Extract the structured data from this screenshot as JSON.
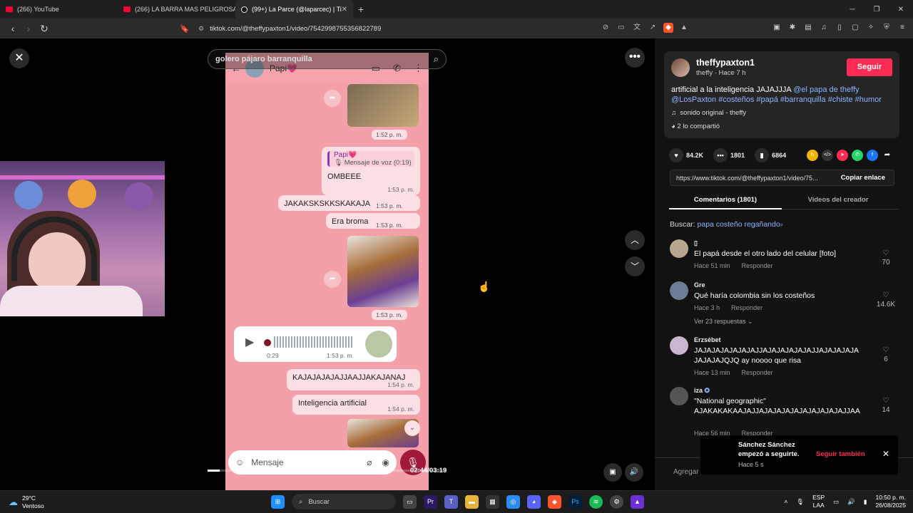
{
  "browser": {
    "tabs": [
      {
        "title": "(266) YouTube",
        "favicon": "youtube-icon"
      },
      {
        "title": "(266) LA BARRA MAS PELIGROSA DE",
        "favicon": "youtube-icon"
      },
      {
        "title": "(99+) La Parce (@laparcec) | Ti",
        "favicon": "tiktok-icon",
        "active": true
      }
    ],
    "new_tab": "+",
    "url": "tiktok.com/@theffypaxton1/video/7542998755356822789"
  },
  "video": {
    "search_query": "golero pájaro barranquilla",
    "time_current": "02:44",
    "time_total": "03:19",
    "progress": 0.05,
    "chat": {
      "contact": "Papi💗",
      "t1": "1:52 p. m.",
      "reply_name": "Papi💗",
      "reply_sub": "🎙 Mensaje de voz (0:19)",
      "m1": "OMBEEE",
      "m1_time": "1:53 p. m.",
      "m2": "JAKAKSKSKKSKAKAJA",
      "m2_time": "1:53 p. m.",
      "m3": "Era broma",
      "m3_time": "1:53 p. m.",
      "t2": "1:53 p. m.",
      "voice_len": "0:29",
      "voice_time": "1:53 p. m.",
      "m4": "KAJAJAJAJAJJAAJJAKAJANAJ",
      "m4_time": "1:54 p. m.",
      "m5": "Inteligencia artificial",
      "m5_time": "1:54 p. m.",
      "input_placeholder": "Mensaje"
    }
  },
  "post": {
    "username": "theffypaxton1",
    "subline": "theffy · Hace 7 h",
    "follow_label": "Seguir",
    "caption_text": "artificial a la inteligencia JAJAJJJA ",
    "caption_tags": "@el papa de theffy @LosPaxton #costeños #papá #barranquilla #chiste #humor",
    "sound": "sonido original - theffy",
    "shared": "2 lo compartió",
    "likes": "84.2K",
    "comments": "1801",
    "saves": "6864",
    "link": "https://www.tiktok.com/@theffypaxton1/video/75...",
    "copy_label": "Copiar enlace",
    "tab_comments": "Comentarios (1801)",
    "tab_videos": "Videos del creador",
    "search_prefix": "Buscar: ",
    "search_link": "papa costeño regañando",
    "add_comment_placeholder": "Agregar"
  },
  "comments": [
    {
      "name": "▯",
      "text": "El papá desde el otro lado del celular [foto]",
      "meta": "Hace 51 min",
      "reply": "Responder",
      "likes": "70",
      "avatar_color": "#b7a58f"
    },
    {
      "name": "Gre",
      "text": "Qué haría colombia sin los costeños",
      "meta": "Hace 3 h",
      "reply": "Responder",
      "likes": "14.6K",
      "replies": "Ver 23 respuestas",
      "avatar_color": "#6e7c95"
    },
    {
      "name": "Erzsébet",
      "text": "JAJAJAJAJAJAJAJJAJAJAJAJAJAJJAJAJAJAJA JAJAJAJQJQ ay noooo que risa",
      "meta": "Hace 13 min",
      "reply": "Responder",
      "likes": "6",
      "avatar_color": "#c9b6cf"
    },
    {
      "name": "iza",
      "text": "\"National geographic\" AJAKAKAKAAJAJJAJAJAJAJAJAJAJAJAJAJJAA",
      "meta": "Hace 56 min",
      "reply": "Responder",
      "likes": "14",
      "avatar_color": "#555555"
    }
  ],
  "toast": {
    "message": "Sánchez Sánchez empezó a seguirte.",
    "ago": "Hace 5 s",
    "action": "Seguir también"
  },
  "taskbar": {
    "temp": "29°C",
    "weather": "Ventoso",
    "search": "Buscar",
    "lang1": "ESP",
    "lang2": "LAA",
    "time": "10:50 p. m.",
    "date": "26/08/2025"
  },
  "colors": {
    "accent": "#fe2c55",
    "tag": "#8cb4ff",
    "chat_bg": "#f4a0aa"
  }
}
